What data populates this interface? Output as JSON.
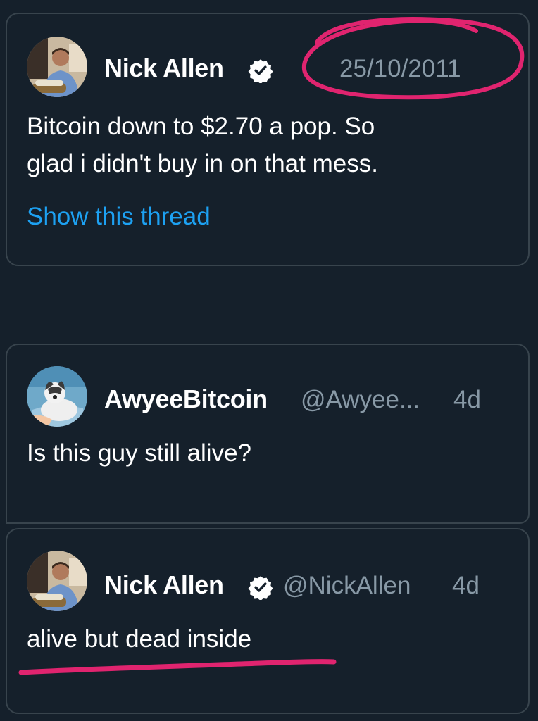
{
  "colors": {
    "background": "#15202b",
    "border": "#38444d",
    "muted": "#8899a6",
    "link": "#1da1f2",
    "annotation": "#e0246f"
  },
  "quoted_tweet": {
    "author_name": "Nick Allen",
    "verified_icon": "verified-badge-icon",
    "date": "25/10/2011",
    "text_line1": "Bitcoin down to $2.70 a pop. So",
    "text_line2": "glad i didn't buy in on that mess.",
    "show_thread": "Show this thread"
  },
  "reply_1": {
    "author_name": "AwyeeBitcoin",
    "handle": "@Awyee...",
    "time": "4d",
    "text": "Is this guy still alive?"
  },
  "reply_2": {
    "author_name": "Nick Allen",
    "verified_icon": "verified-badge-icon",
    "handle": "@NickAllen",
    "time": "4d",
    "text": "alive but dead inside"
  }
}
